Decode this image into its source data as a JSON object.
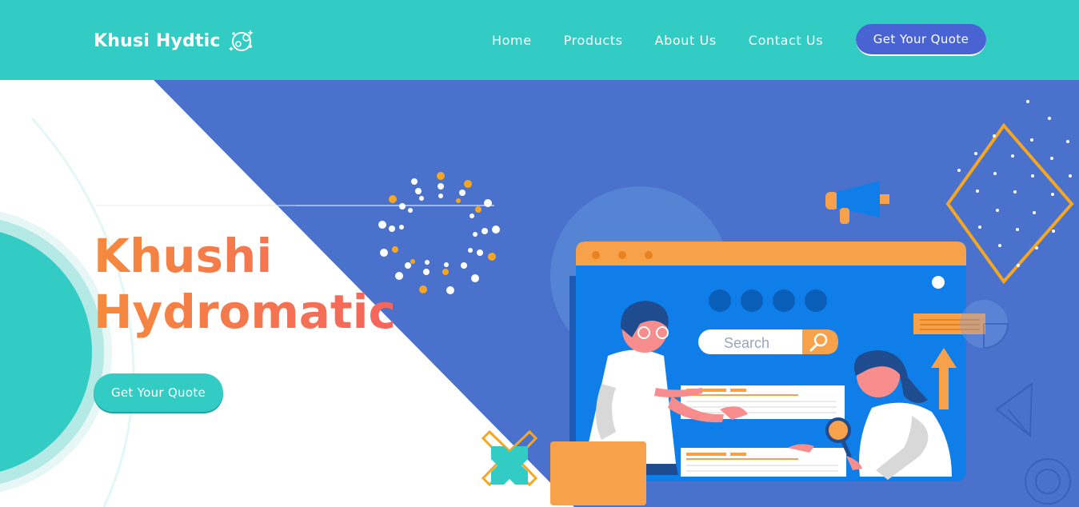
{
  "navbar": {
    "brand": "Khusi Hydtic",
    "links": [
      "Home",
      "Products",
      "About Us",
      "Contact Us"
    ],
    "cta": "Get Your Quote"
  },
  "hero": {
    "title_line1": "Khushi",
    "title_line2": "Hydromatic",
    "cta": "Get Your Quote"
  },
  "illustration": {
    "search_placeholder": "Search"
  },
  "colors": {
    "teal": "#33ccc5",
    "blue_panel": "#4a72cc",
    "screen_blue": "#0f7ee8",
    "orange": "#f7a14b",
    "title_gradient_start": "#f58a3c",
    "title_gradient_end": "#f4655e"
  },
  "icons": [
    "bubbles-logo-icon",
    "magnifier-icon",
    "megaphone-icon",
    "arrow-up-icon",
    "cross-icon",
    "paper-plane-icon"
  ]
}
